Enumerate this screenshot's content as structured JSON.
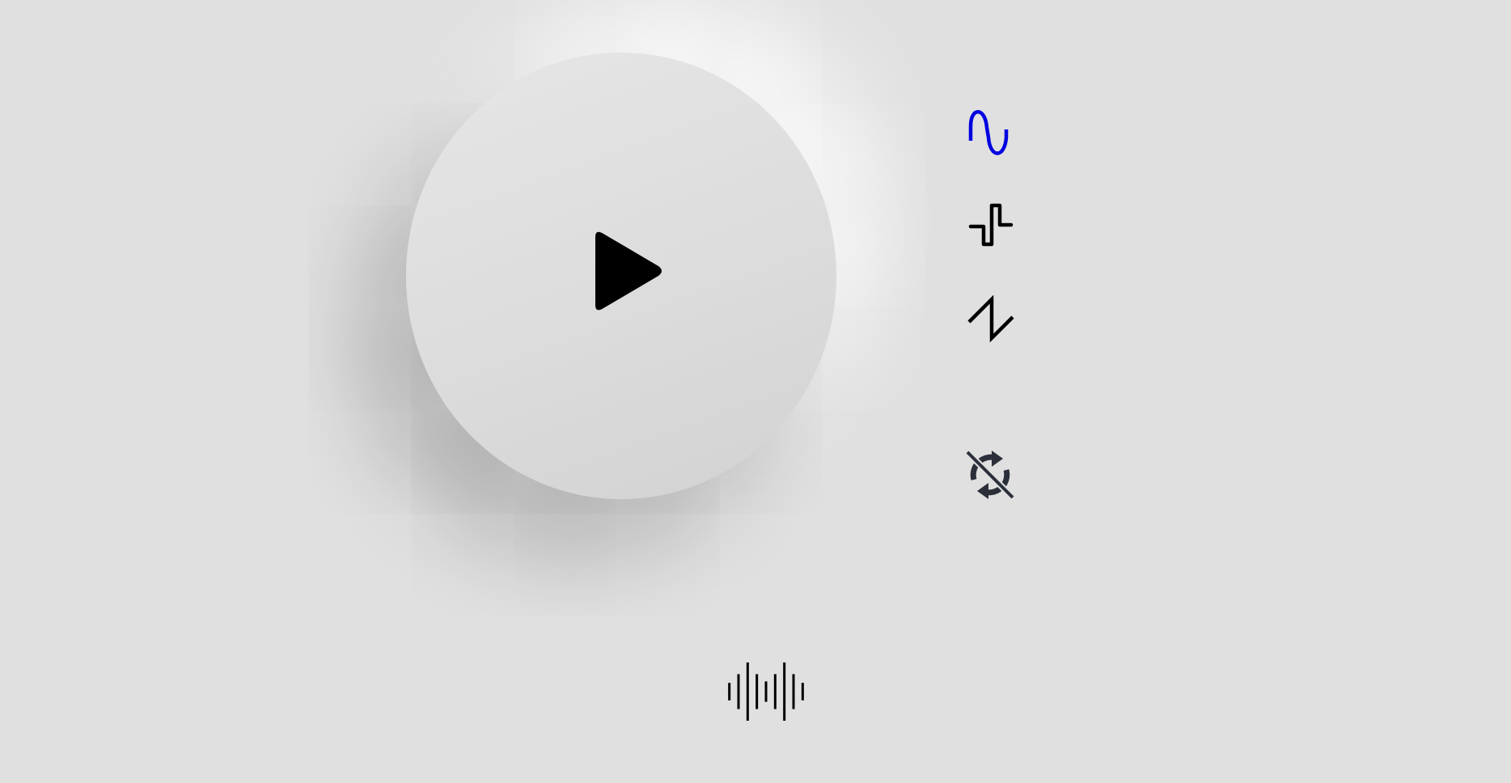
{
  "app": {
    "background_color": "#e0e0e0",
    "accent_color": "#0000e0",
    "icon_color": "#000000",
    "loop_icon_color": "#2b2f3a"
  },
  "player": {
    "state": "paused",
    "play_icon": "play-icon"
  },
  "waveforms": [
    {
      "name": "sine",
      "icon": "sine-wave-icon",
      "selected": true
    },
    {
      "name": "square",
      "icon": "square-wave-icon",
      "selected": false
    },
    {
      "name": "sawtooth",
      "icon": "sawtooth-wave-icon",
      "selected": false
    }
  ],
  "loop": {
    "enabled": false,
    "icon": "loop-off-icon"
  },
  "visualizer": {
    "icon": "audio-waveform-icon",
    "bar_levels": [
      0.3,
      0.6,
      1.0,
      0.6,
      0.35,
      0.6,
      1.0,
      0.6,
      0.3
    ]
  }
}
